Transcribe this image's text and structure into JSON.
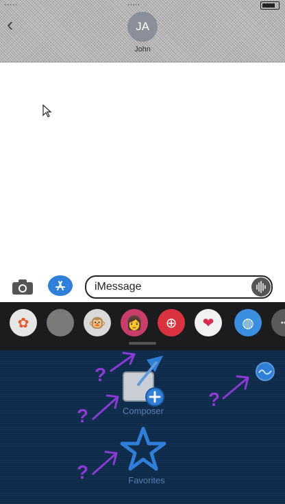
{
  "header": {
    "avatar_initials": "JA",
    "contact_name": "John"
  },
  "compose": {
    "placeholder": "iMessage"
  },
  "drawer": {
    "apps": [
      {
        "name": "photos-app-icon",
        "glyph": "✿",
        "bg": "#e6e6e6",
        "fg": "#e4592a"
      },
      {
        "name": "search-images-app-icon",
        "glyph": "",
        "bg": "#7a7a7a",
        "fg": "#ffffff"
      },
      {
        "name": "animoji-monkey-icon",
        "glyph": "🐵",
        "bg": "#d9d9d9",
        "fg": "#000000"
      },
      {
        "name": "memoji-icon",
        "glyph": "👩",
        "bg": "#c93d6a",
        "fg": "#000000"
      },
      {
        "name": "images-search-icon",
        "glyph": "⊕",
        "bg": "#d8333f",
        "fg": "#ffffff"
      },
      {
        "name": "digital-touch-icon",
        "glyph": "❤",
        "bg": "#f1f1f1",
        "fg": "#d82a4f"
      },
      {
        "name": "music-app-icon",
        "glyph": "◍",
        "bg": "#3c8ee0",
        "fg": "#ffffff"
      },
      {
        "name": "more-apps-icon",
        "glyph": "•••",
        "bg": "#5a5a5a",
        "fg": "#dddddd"
      }
    ]
  },
  "panel": {
    "composer_label": "Composer",
    "favorites_label": "Favorites"
  },
  "colors": {
    "panel_bg": "#0d2a4a",
    "accent_blue": "#2f7fd8",
    "annotation_purple": "#8b3ad6"
  }
}
